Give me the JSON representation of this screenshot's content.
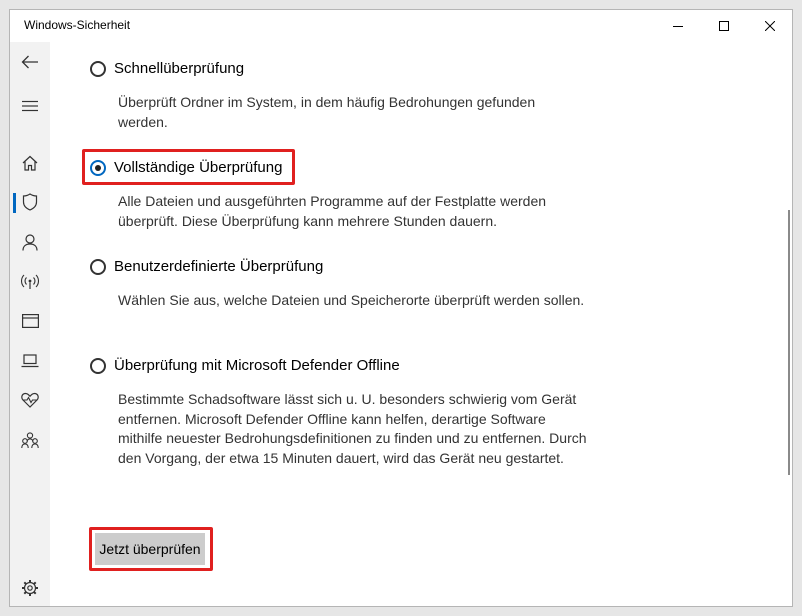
{
  "window": {
    "title": "Windows-Sicherheit"
  },
  "sidebar": {
    "items": [
      {
        "icon": "back-arrow-icon"
      },
      {
        "icon": "hamburger-menu-icon"
      },
      {
        "icon": "home-icon"
      },
      {
        "icon": "shield-icon",
        "active": true
      },
      {
        "icon": "person-icon"
      },
      {
        "icon": "wireless-icon"
      },
      {
        "icon": "app-browser-icon"
      },
      {
        "icon": "laptop-icon"
      },
      {
        "icon": "heart-pulse-icon"
      },
      {
        "icon": "family-icon"
      },
      {
        "icon": "gear-icon"
      }
    ]
  },
  "scan_options": [
    {
      "label": "Schnellüberprüfung",
      "description": "Überprüft Ordner im System, in dem häufig Bedrohungen gefunden werden.",
      "selected": false
    },
    {
      "label": "Vollständige Überprüfung",
      "description": "Alle Dateien und ausgeführten Programme auf der Festplatte werden überprüft. Diese Überprüfung kann mehrere Stunden dauern.",
      "selected": true
    },
    {
      "label": "Benutzerdefinierte Überprüfung",
      "description": "Wählen Sie aus, welche Dateien und Speicherorte überprüft werden sollen.",
      "selected": false
    },
    {
      "label": "Überprüfung mit Microsoft Defender Offline",
      "description": "Bestimmte Schadsoftware lässt sich u. U. besonders schwierig vom Gerät entfernen. Microsoft Defender Offline kann helfen, derartige Software mithilfe neuester Bedrohungsdefinitionen zu finden und zu entfernen. Durch den Vorgang, der etwa 15 Minuten dauert, wird das Gerät neu gestartet.",
      "selected": false
    }
  ],
  "actions": {
    "scan_now_label": "Jetzt überprüfen"
  },
  "colors": {
    "accent": "#0067c0",
    "highlight": "#e0201f",
    "button": "#cccccc"
  }
}
